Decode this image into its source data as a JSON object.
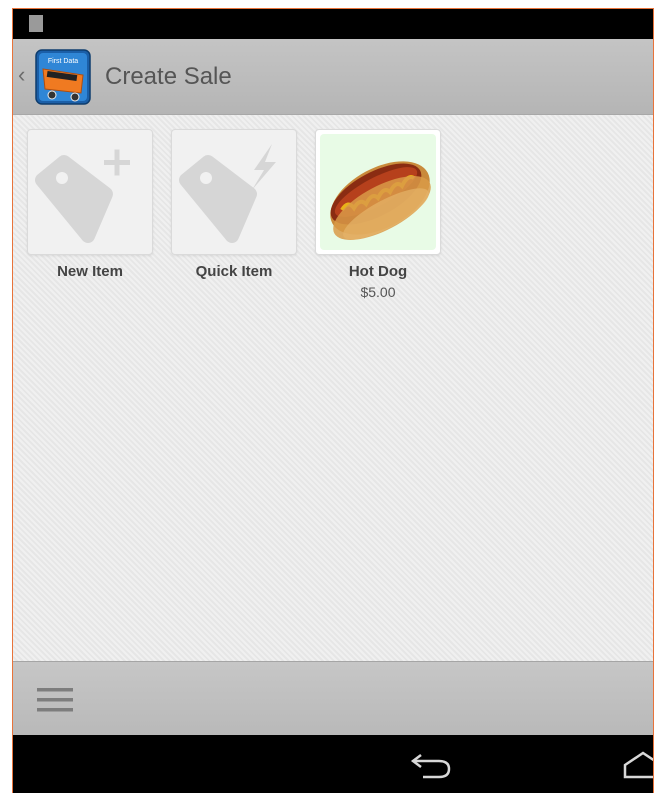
{
  "header": {
    "title": "Create Sale",
    "app_icon": "first-data-app-icon",
    "app_icon_text": "First Data"
  },
  "items": [
    {
      "label": "New Item",
      "price": "",
      "icon": "tag-plus-icon"
    },
    {
      "label": "Quick Item",
      "price": "",
      "icon": "tag-lightning-icon"
    },
    {
      "label": "Hot Dog",
      "price": "$5.00",
      "icon": "hot-dog-image"
    }
  ],
  "footer": {
    "menu_icon": "hamburger-menu-icon"
  },
  "navigation": {
    "back_icon": "back-arrow-icon",
    "home_icon": "home-icon"
  },
  "colors": {
    "accent_border": "#e8733a",
    "action_bar": "#bdbdbd",
    "content_bg": "#ebebeb"
  }
}
